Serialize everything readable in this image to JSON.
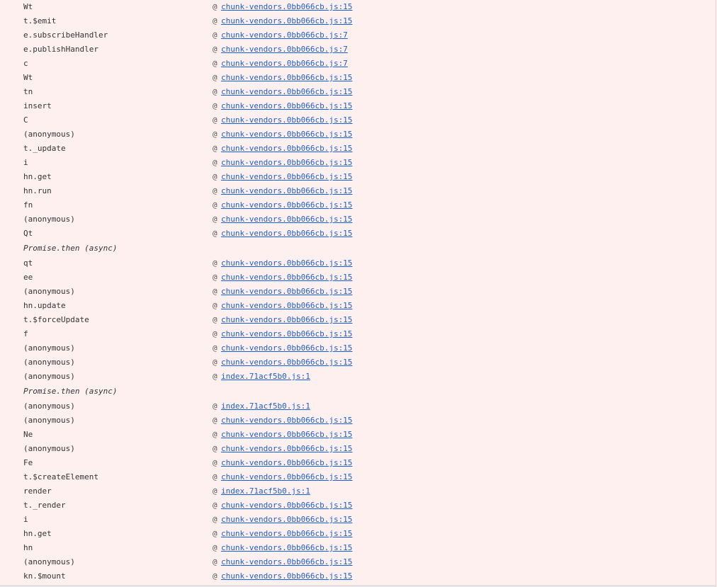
{
  "frames": [
    {
      "fn": "Wt",
      "src": "chunk-vendors.0bb066cb.js:15"
    },
    {
      "fn": "t.$emit",
      "src": "chunk-vendors.0bb066cb.js:15"
    },
    {
      "fn": "e.subscribeHandler",
      "src": "chunk-vendors.0bb066cb.js:7"
    },
    {
      "fn": "e.publishHandler",
      "src": "chunk-vendors.0bb066cb.js:7"
    },
    {
      "fn": "c",
      "src": "chunk-vendors.0bb066cb.js:7"
    },
    {
      "fn": "Wt",
      "src": "chunk-vendors.0bb066cb.js:15"
    },
    {
      "fn": "tn",
      "src": "chunk-vendors.0bb066cb.js:15"
    },
    {
      "fn": "insert",
      "src": "chunk-vendors.0bb066cb.js:15"
    },
    {
      "fn": "C",
      "src": "chunk-vendors.0bb066cb.js:15"
    },
    {
      "fn": "(anonymous)",
      "src": "chunk-vendors.0bb066cb.js:15"
    },
    {
      "fn": "t._update",
      "src": "chunk-vendors.0bb066cb.js:15"
    },
    {
      "fn": "i",
      "src": "chunk-vendors.0bb066cb.js:15"
    },
    {
      "fn": "hn.get",
      "src": "chunk-vendors.0bb066cb.js:15"
    },
    {
      "fn": "hn.run",
      "src": "chunk-vendors.0bb066cb.js:15"
    },
    {
      "fn": "fn",
      "src": "chunk-vendors.0bb066cb.js:15"
    },
    {
      "fn": "(anonymous)",
      "src": "chunk-vendors.0bb066cb.js:15"
    },
    {
      "fn": "Qt",
      "src": "chunk-vendors.0bb066cb.js:15"
    },
    {
      "async": "Promise.then (async)"
    },
    {
      "fn": "qt",
      "src": "chunk-vendors.0bb066cb.js:15"
    },
    {
      "fn": "ee",
      "src": "chunk-vendors.0bb066cb.js:15"
    },
    {
      "fn": "(anonymous)",
      "src": "chunk-vendors.0bb066cb.js:15"
    },
    {
      "fn": "hn.update",
      "src": "chunk-vendors.0bb066cb.js:15"
    },
    {
      "fn": "t.$forceUpdate",
      "src": "chunk-vendors.0bb066cb.js:15"
    },
    {
      "fn": "f",
      "src": "chunk-vendors.0bb066cb.js:15"
    },
    {
      "fn": "(anonymous)",
      "src": "chunk-vendors.0bb066cb.js:15"
    },
    {
      "fn": "(anonymous)",
      "src": "chunk-vendors.0bb066cb.js:15"
    },
    {
      "fn": "(anonymous)",
      "src": "index.71acf5b0.js:1"
    },
    {
      "async": "Promise.then (async)"
    },
    {
      "fn": "(anonymous)",
      "src": "index.71acf5b0.js:1"
    },
    {
      "fn": "(anonymous)",
      "src": "chunk-vendors.0bb066cb.js:15"
    },
    {
      "fn": "Ne",
      "src": "chunk-vendors.0bb066cb.js:15"
    },
    {
      "fn": "(anonymous)",
      "src": "chunk-vendors.0bb066cb.js:15"
    },
    {
      "fn": "Fe",
      "src": "chunk-vendors.0bb066cb.js:15"
    },
    {
      "fn": "t.$createElement",
      "src": "chunk-vendors.0bb066cb.js:15"
    },
    {
      "fn": "render",
      "src": "index.71acf5b0.js:1"
    },
    {
      "fn": "t._render",
      "src": "chunk-vendors.0bb066cb.js:15"
    },
    {
      "fn": "i",
      "src": "chunk-vendors.0bb066cb.js:15"
    },
    {
      "fn": "hn.get",
      "src": "chunk-vendors.0bb066cb.js:15"
    },
    {
      "fn": "hn",
      "src": "chunk-vendors.0bb066cb.js:15"
    },
    {
      "fn": "(anonymous)",
      "src": "chunk-vendors.0bb066cb.js:15"
    },
    {
      "fn": "kn.$mount",
      "src": "chunk-vendors.0bb066cb.js:15"
    }
  ],
  "at_symbol": "@",
  "colors": {
    "background": "#fff0f0",
    "link": "#1a5fd1",
    "text": "#333333"
  }
}
